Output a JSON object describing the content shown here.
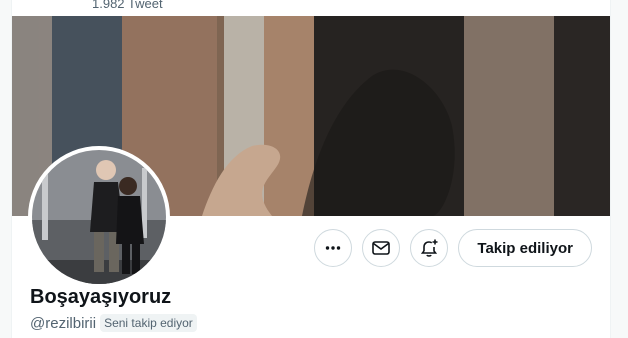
{
  "header": {
    "tweet_count": "1.982 Tweet"
  },
  "profile": {
    "display_name": "Boşayaşıyoruz",
    "handle": "@rezilbirii",
    "follows_you_badge": "Seni takip ediyor"
  },
  "actions": {
    "more_icon": "more-horizontal-icon",
    "message_icon": "envelope-icon",
    "notify_icon": "bell-plus-icon",
    "follow_label": "Takip ediliyor"
  },
  "colors": {
    "text_primary": "#0f1419",
    "text_secondary": "#536471",
    "border": "#cfd9de",
    "badge_bg": "#eff3f4"
  }
}
